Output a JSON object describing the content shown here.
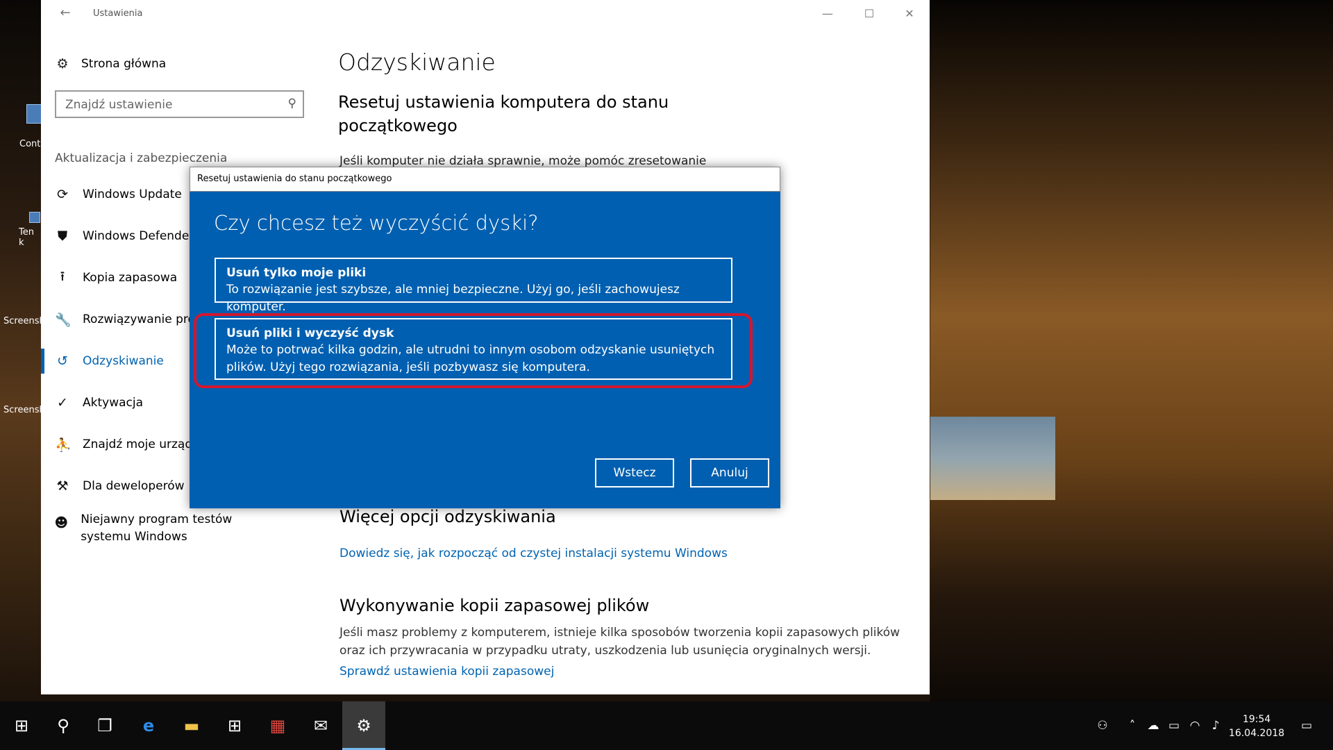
{
  "window": {
    "title": "Ustawienia",
    "back_glyph": "←",
    "minimize_glyph": "—",
    "maximize_glyph": "☐",
    "close_glyph": "✕"
  },
  "desktop_icons": [
    {
      "label": "Cont"
    },
    {
      "label": "Ten k"
    },
    {
      "label": "Screensh"
    },
    {
      "label": "Screensh"
    }
  ],
  "sidebar": {
    "home_label": "Strona główna",
    "search_placeholder": "Znajdź ustawienie",
    "section_label": "Aktualizacja i zabezpieczenia",
    "items": [
      {
        "label": "Windows Update",
        "icon": "sync-icon"
      },
      {
        "label": "Windows Defender",
        "icon": "shield-icon"
      },
      {
        "label": "Kopia zapasowa",
        "icon": "upload-icon"
      },
      {
        "label": "Rozwiązywanie problemów",
        "icon": "wrench-icon"
      },
      {
        "label": "Odzyskiwanie",
        "icon": "history-icon",
        "active": true
      },
      {
        "label": "Aktywacja",
        "icon": "check-circle-icon"
      },
      {
        "label": "Znajdź moje urządzenie",
        "icon": "person-location-icon"
      },
      {
        "label": "Dla deweloperów",
        "icon": "dev-tools-icon"
      },
      {
        "label": "Niejawny program testów systemu Windows",
        "icon": "insider-icon"
      }
    ]
  },
  "main": {
    "title": "Odzyskiwanie",
    "reset_heading": "Resetuj ustawienia komputera do stanu początkowego",
    "reset_desc_partial": "Jeśli komputer nie działa sprawnie, może pomóc zresetowanie",
    "more_options_heading": "Więcej opcji odzyskiwania",
    "more_options_link": "Dowiedz się, jak rozpocząć od czystej instalacji systemu Windows",
    "backup_heading": "Wykonywanie kopii zapasowej plików",
    "backup_desc": "Jeśli masz problemy z komputerem, istnieje kilka sposobów tworzenia kopii zapasowych plików oraz ich przywracania w przypadku utraty, uszkodzenia lub usunięcia oryginalnych wersji.",
    "backup_link": "Sprawdź ustawienia kopii zapasowej"
  },
  "dialog": {
    "title": "Resetuj ustawienia do stanu początkowego",
    "question": "Czy chcesz też wyczyścić dyski?",
    "options": [
      {
        "title": "Usuń tylko moje pliki",
        "desc": "To rozwiązanie jest szybsze, ale mniej bezpieczne. Użyj go, jeśli zachowujesz komputer."
      },
      {
        "title": "Usuń pliki i wyczyść dysk",
        "desc": "Może to potrwać kilka godzin, ale utrudni to innym osobom odzyskanie usuniętych plików. Użyj tego rozwiązania, jeśli pozbywasz się komputera."
      }
    ],
    "back_button": "Wstecz",
    "cancel_button": "Anuluj",
    "highlight_color": "#d3172f"
  },
  "taskbar": {
    "clock_time": "19:54",
    "clock_date": "16.04.2018",
    "accent": "#76b9ed"
  }
}
